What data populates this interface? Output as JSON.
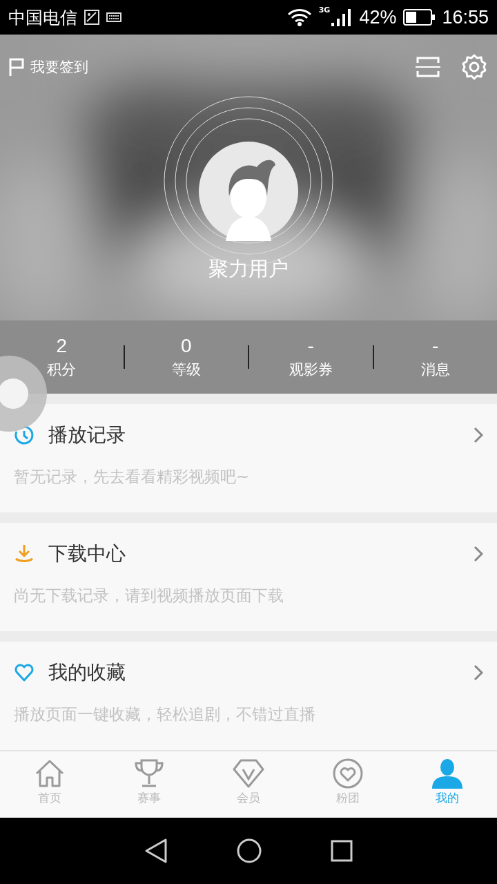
{
  "status_bar": {
    "carrier": "中国电信",
    "network": "3G",
    "battery": "42%",
    "time": "16:55"
  },
  "header": {
    "checkin": "我要签到"
  },
  "profile": {
    "username": "聚力用户"
  },
  "stats": [
    {
      "value": "2",
      "label": "积分"
    },
    {
      "value": "0",
      "label": "等级"
    },
    {
      "value": "-",
      "label": "观影券"
    },
    {
      "value": "-",
      "label": "消息"
    }
  ],
  "sections": [
    {
      "kind": "history",
      "title": "播放记录",
      "hint": "暂无记录，先去看看精彩视频吧~"
    },
    {
      "kind": "download",
      "title": "下载中心",
      "hint": "尚无下载记录，请到视频播放页面下载"
    },
    {
      "kind": "favorite",
      "title": "我的收藏",
      "hint": "播放页面一键收藏，轻松追剧，不错过直播"
    }
  ],
  "tabs": [
    {
      "kind": "home",
      "label": "首页",
      "selected": false
    },
    {
      "kind": "trophy",
      "label": "赛事",
      "selected": false
    },
    {
      "kind": "vip",
      "label": "会员",
      "selected": false
    },
    {
      "kind": "fans",
      "label": "粉团",
      "selected": false
    },
    {
      "kind": "me",
      "label": "我的",
      "selected": true
    }
  ]
}
